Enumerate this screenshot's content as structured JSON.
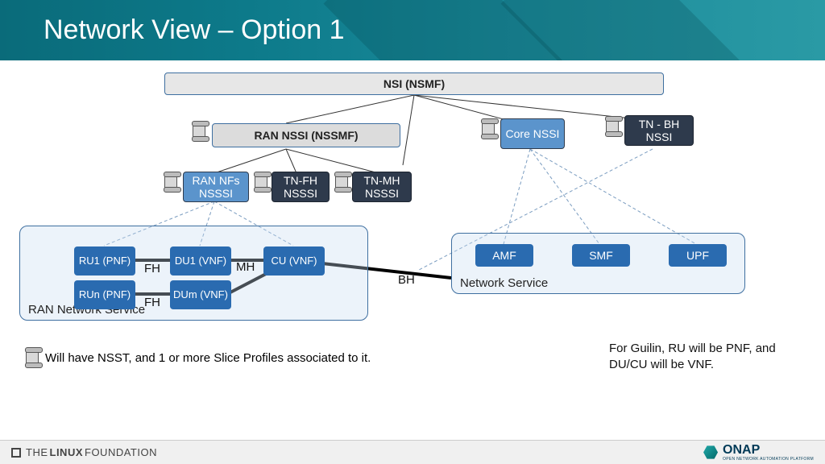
{
  "slide": {
    "title": "Network View – Option 1"
  },
  "nodes": {
    "nsi": {
      "label": "NSI (NSMF)"
    },
    "ran_nssi": {
      "label": "RAN NSSI (NSSMF)"
    },
    "core_nssi": {
      "label": "Core NSSI"
    },
    "tn_bh": {
      "label": "TN - BH NSSI"
    },
    "ran_nfs": {
      "label": "RAN NFs NSSSI"
    },
    "tn_fh": {
      "label": "TN-FH NSSSI"
    },
    "tn_mh": {
      "label": "TN-MH NSSSI"
    },
    "ru1": {
      "label": "RU1 (PNF)"
    },
    "du1": {
      "label": "DU1 (VNF)"
    },
    "cu": {
      "label": "CU (VNF)"
    },
    "run": {
      "label": "RUn (PNF)"
    },
    "dum": {
      "label": "DUm (VNF)"
    },
    "amf": {
      "label": "AMF"
    },
    "smf": {
      "label": "SMF"
    },
    "upf": {
      "label": "UPF"
    }
  },
  "groups": {
    "ran_ns": {
      "caption": "RAN Network Service"
    },
    "core_ns": {
      "caption": "Network Service"
    }
  },
  "edge_labels": {
    "fh1": "FH",
    "fh2": "FH",
    "mh": "MH",
    "bh": "BH"
  },
  "legend": {
    "text": "Will have NSST, and 1 or more Slice Profiles associated to it."
  },
  "note": {
    "text": "For Guilin, RU will be PNF, and DU/CU will be VNF."
  },
  "footer": {
    "linux1": "THE",
    "linux2": "LINUX",
    "linux3": "FOUNDATION",
    "onap": "ONAP",
    "onap_sub": "OPEN NETWORK AUTOMATION PLATFORM"
  }
}
